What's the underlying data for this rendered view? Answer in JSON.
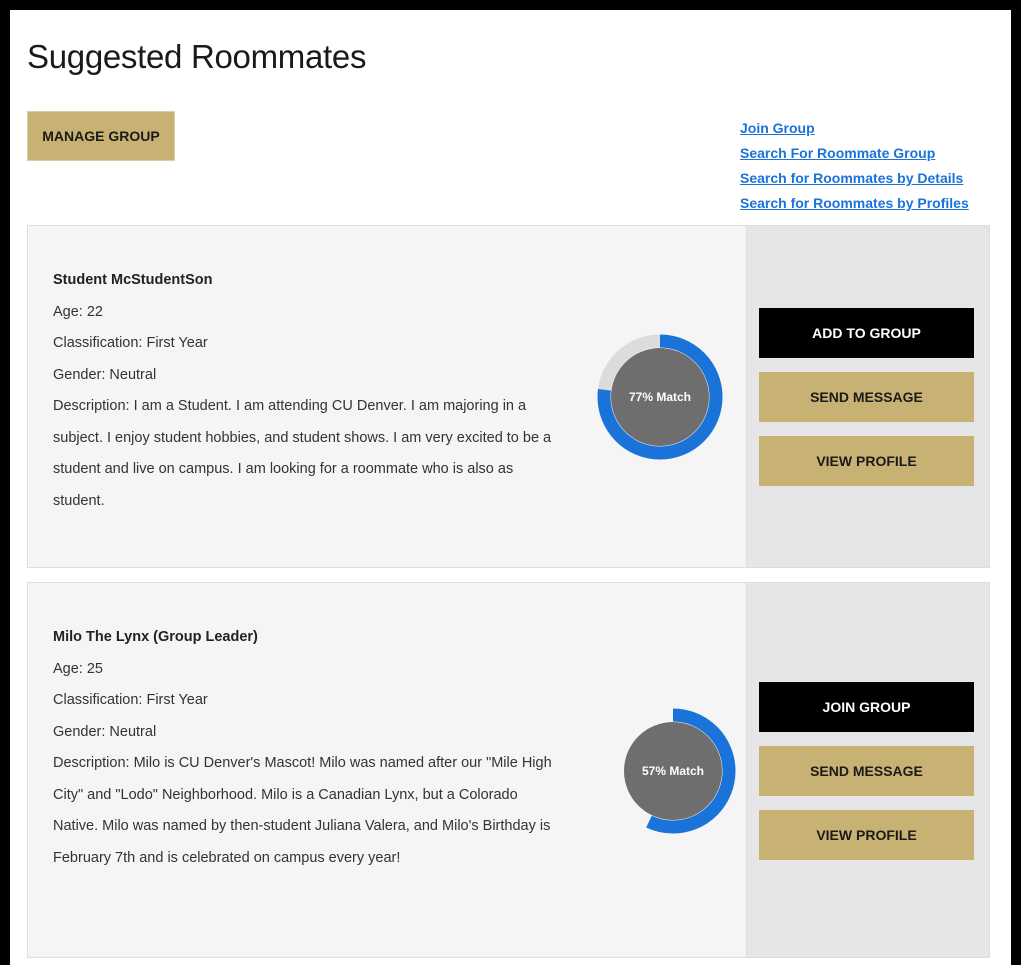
{
  "page": {
    "title": "Suggested Roommates"
  },
  "toolbar": {
    "manage_group_label": "MANAGE GROUP"
  },
  "links": [
    "Join Group",
    "Search For Roommate Group",
    "Search for Roommates by Details",
    "Search for Roommates by Profiles"
  ],
  "colors": {
    "gold": "#c8b273",
    "ring_blue": "#1a73d9",
    "ring_gray": "#6e6e6e"
  },
  "roommates": [
    {
      "name": "Student McStudentSon",
      "age": "Age: 22",
      "classification": "Classification: First Year",
      "gender": "Gender: Neutral",
      "description": "Description: I am a Student. I am attending CU Denver. I am majoring in a subject. I enjoy student hobbies, and student shows. I am very excited to be a student and live on campus. I am looking for a roommate who is also as student.",
      "match_label": "77% Match",
      "match_percent": 77,
      "primary_action": "ADD TO GROUP",
      "message_action": "SEND MESSAGE",
      "profile_action": "VIEW PROFILE"
    },
    {
      "name": "Milo The Lynx (Group Leader)",
      "age": "Age: 25",
      "classification": "Classification: First Year",
      "gender": "Gender: Neutral",
      "description": "Description: Milo is CU Denver's Mascot! Milo was named after our \"Mile High City\" and \"Lodo\" Neighborhood. Milo is a Canadian Lynx, but a Colorado Native. Milo was named by then-student Juliana Valera, and Milo's Birthday is February 7th and is celebrated on campus every year!",
      "match_label": "57% Match",
      "match_percent": 57,
      "primary_action": "JOIN GROUP",
      "message_action": "SEND MESSAGE",
      "profile_action": "VIEW PROFILE"
    }
  ]
}
